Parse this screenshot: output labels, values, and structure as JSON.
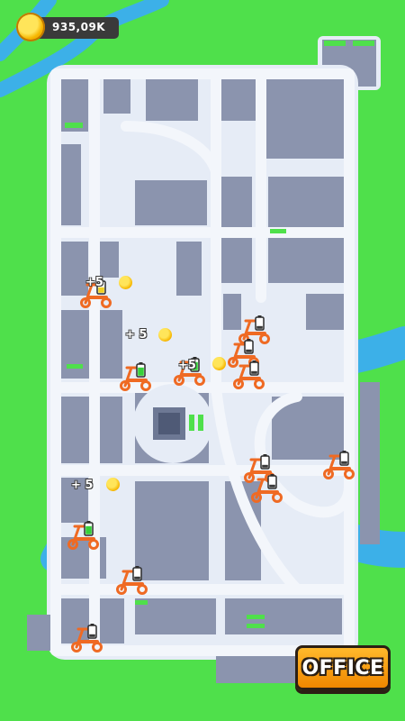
{
  "hud": {
    "coins": "935,09K",
    "coin_icon": "gold-coin-icon"
  },
  "office_button": {
    "label": "OFFICE"
  },
  "rewards": [
    {
      "label": "+5"
    },
    {
      "label": "+ 5"
    },
    {
      "label": "+5"
    },
    {
      "label": "+ 5"
    }
  ],
  "scooter_battery_levels": [
    "medium",
    "high",
    "high",
    "low",
    "low",
    "low",
    "low",
    "low",
    "high",
    "low",
    "low",
    "low"
  ],
  "colors": {
    "grass": "#4fe04b",
    "water": "#3cb0e8",
    "road": "#e6ecf6",
    "block": "#8b94ae",
    "scooter": "#ef6a23"
  }
}
